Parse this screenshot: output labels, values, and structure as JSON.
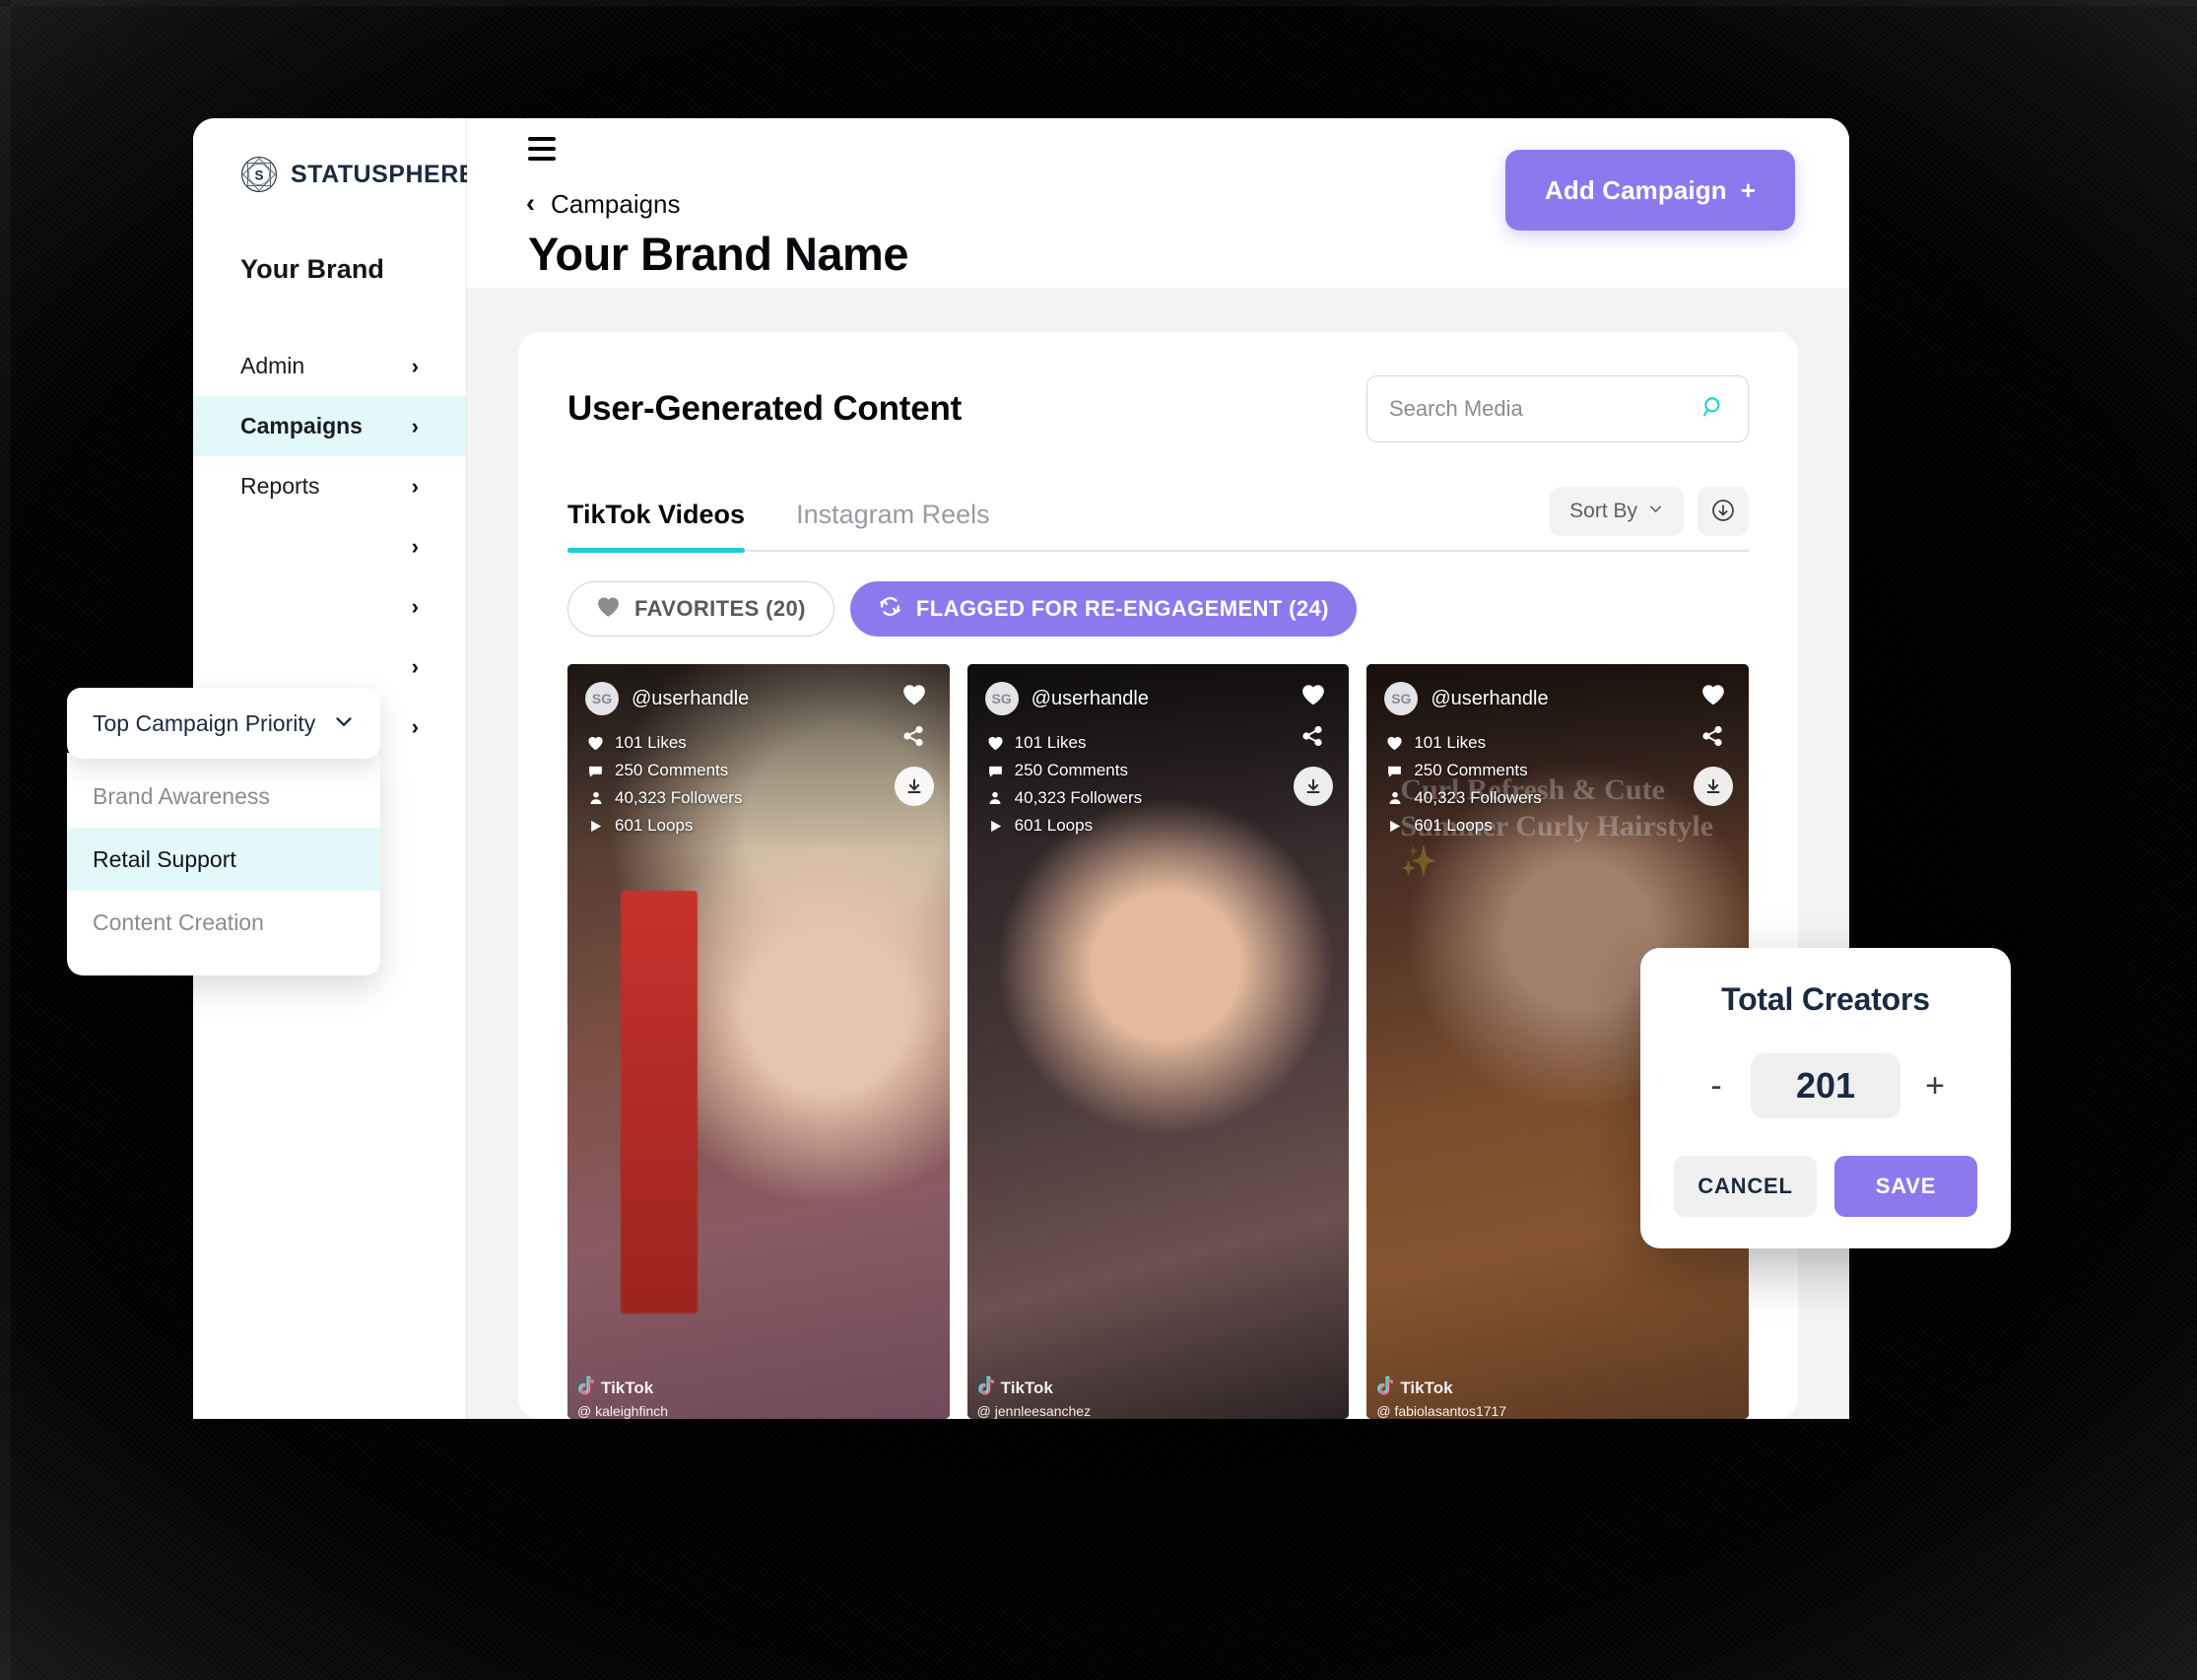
{
  "sidebar": {
    "logo_text": "STATUSPHERE",
    "brand_name": "Your Brand",
    "nav_items": [
      {
        "label": "Admin",
        "chevron": "›",
        "active": false
      },
      {
        "label": "Campaigns",
        "chevron": "›",
        "active": true
      },
      {
        "label": "Reports",
        "chevron": "›",
        "active": false
      },
      {
        "label": "",
        "chevron": "›",
        "active": false
      },
      {
        "label": "",
        "chevron": "›",
        "active": false
      },
      {
        "label": "",
        "chevron": "›",
        "active": false
      },
      {
        "label": "",
        "chevron": "›",
        "active": false
      }
    ]
  },
  "topbar": {
    "breadcrumb_back": "‹",
    "breadcrumb_label": "Campaigns",
    "page_title": "Your Brand Name",
    "add_campaign_label": "Add Campaign",
    "add_campaign_plus": "+"
  },
  "ugc": {
    "title": "User-Generated Content",
    "search_placeholder": "Search Media",
    "search_value": "",
    "tabs": [
      {
        "label": "TikTok Videos",
        "active": true
      },
      {
        "label": "Instagram Reels",
        "active": false
      }
    ],
    "sort_by_label": "Sort By",
    "sort_by_chevron": "∨",
    "pills": [
      {
        "label": "FAVORITES (20)",
        "style": "outline",
        "icon": "heart-icon"
      },
      {
        "label": "FLAGGED FOR RE-ENGAGEMENT (24)",
        "style": "filled",
        "icon": "refresh-icon"
      }
    ],
    "cards": [
      {
        "avatar_initials": "SG",
        "handle": "@userhandle",
        "likes": "101 Likes",
        "comments": "250 Comments",
        "followers": "40,323 Followers",
        "loops": "601 Loops",
        "watermark_brand": "TikTok",
        "watermark_handle": "@ kaleighfinch",
        "video_caption": ""
      },
      {
        "avatar_initials": "SG",
        "handle": "@userhandle",
        "likes": "101 Likes",
        "comments": "250 Comments",
        "followers": "40,323 Followers",
        "loops": "601 Loops",
        "watermark_brand": "TikTok",
        "watermark_handle": "@ jennleesanchez",
        "video_caption": ""
      },
      {
        "avatar_initials": "SG",
        "handle": "@userhandle",
        "likes": "101 Likes",
        "comments": "250 Comments",
        "followers": "40,323 Followers",
        "loops": "601 Loops",
        "watermark_brand": "TikTok",
        "watermark_handle": "@ fabiolasantos1717",
        "video_caption": "Curl Refresh & Cute Summer Curly Hairstyle ✨"
      }
    ]
  },
  "priority_dropdown": {
    "selected_label": "Top Campaign Priority",
    "chevron": "∨",
    "options": [
      {
        "label": "Brand Awareness",
        "selected": false
      },
      {
        "label": "Retail Support",
        "selected": true
      },
      {
        "label": "Content Creation",
        "selected": false
      }
    ]
  },
  "creators_modal": {
    "title": "Total Creators",
    "decrement_label": "-",
    "value": "201",
    "increment_label": "+",
    "cancel_label": "CANCEL",
    "save_label": "SAVE"
  },
  "colors": {
    "accent_purple": "#8c79ee",
    "accent_teal": "#17cfd0",
    "highlight_cyan": "#e3f8f9",
    "navy": "#1b2a41",
    "page_bg": "#f4f4f4"
  }
}
